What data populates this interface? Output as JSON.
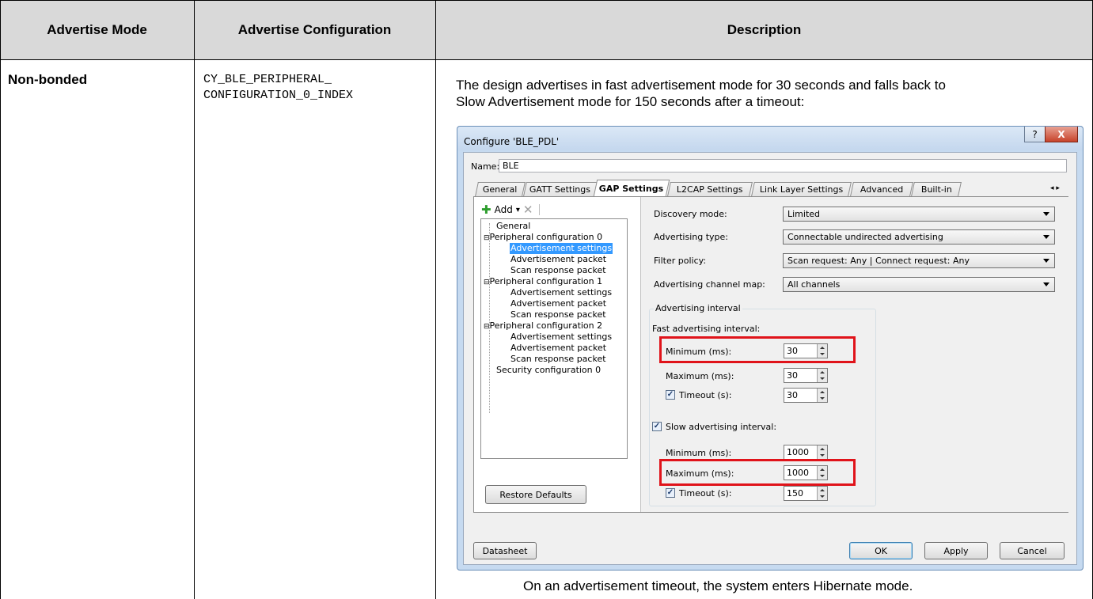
{
  "table": {
    "headers": [
      "Advertise Mode",
      "Advertise Configuration",
      "Description"
    ],
    "row": {
      "mode": "Non-bonded",
      "config_line1": "CY_BLE_PERIPHERAL_",
      "config_line2": "CONFIGURATION_0_INDEX",
      "desc_line1": "The design advertises in fast advertisement mode for 30 seconds and falls back to",
      "desc_line2": "Slow Advertisement mode for 150 seconds after a timeout:",
      "caption": "On an advertisement timeout, the system enters Hibernate mode."
    }
  },
  "dialog": {
    "title": "Configure 'BLE_PDL'",
    "help_glyph": "?",
    "close_glyph": "X",
    "name_label": "Name:",
    "name_value": "BLE",
    "tabs": [
      "General",
      "GATT Settings",
      "GAP Settings",
      "L2CAP Settings",
      "Link Layer Settings",
      "Advanced",
      "Built-in"
    ],
    "active_tab": "GAP Settings",
    "tab_scroll_glyph": "◂ ▸",
    "tree_toolbar": {
      "add_label": "Add",
      "add_glyph": "✚",
      "dropdown_glyph": "▾",
      "delete_glyph": "✕"
    },
    "tree": [
      "General",
      "Peripheral configuration 0",
      "Advertisement settings",
      "Advertisement packet",
      "Scan response packet",
      "Peripheral configuration 1",
      "Advertisement settings",
      "Advertisement packet",
      "Scan response packet",
      "Peripheral configuration 2",
      "Advertisement settings",
      "Advertisement packet",
      "Scan response packet",
      "Security configuration 0"
    ],
    "restore_defaults": "Restore Defaults",
    "fields": {
      "discovery_mode_label": "Discovery mode:",
      "discovery_mode_value": "Limited",
      "adv_type_label": "Advertising type:",
      "adv_type_value": "Connectable undirected advertising",
      "filter_policy_label": "Filter policy:",
      "filter_policy_value": "Scan request: Any | Connect request: Any",
      "channel_map_label": "Advertising channel map:",
      "channel_map_value": "All channels"
    },
    "adv_interval": {
      "group_label": "Advertising interval",
      "fast_label": "Fast advertising interval:",
      "fast_min_label": "Minimum (ms):",
      "fast_min_value": "30",
      "fast_max_label": "Maximum (ms):",
      "fast_max_value": "30",
      "fast_timeout_label": "Timeout (s):",
      "fast_timeout_value": "30",
      "slow_label": "Slow advertising interval:",
      "slow_min_label": "Minimum (ms):",
      "slow_min_value": "1000",
      "slow_max_label": "Maximum (ms):",
      "slow_max_value": "1000",
      "slow_timeout_label": "Timeout (s):",
      "slow_timeout_value": "150",
      "check_glyph": "✓"
    },
    "buttons": {
      "datasheet": "Datasheet",
      "ok": "OK",
      "apply": "Apply",
      "cancel": "Cancel"
    }
  },
  "colors": {
    "header_bg": "#d9d9d9",
    "highlight": "#e0131a",
    "selection": "#3399ff"
  }
}
